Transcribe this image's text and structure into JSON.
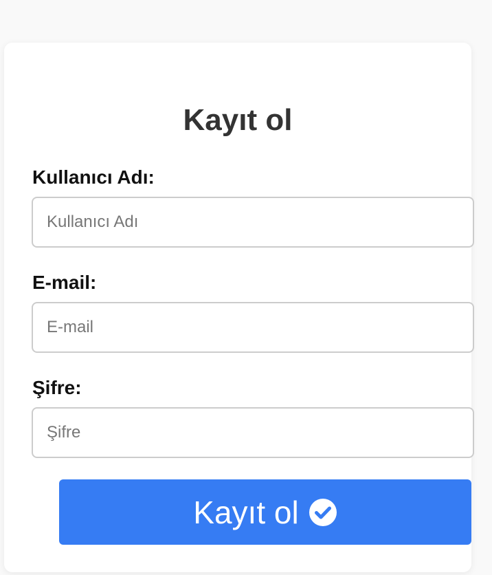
{
  "form": {
    "title": "Kayıt ol",
    "fields": [
      {
        "label": "Kullanıcı Adı:",
        "placeholder": "Kullanıcı Adı",
        "value": ""
      },
      {
        "label": "E-mail:",
        "placeholder": "E-mail",
        "value": ""
      },
      {
        "label": "Şifre:",
        "placeholder": "Şifre",
        "value": ""
      }
    ],
    "submit": {
      "label": "Kayıt ol",
      "icon": "check-circle-icon",
      "color": "#367cf3"
    }
  }
}
